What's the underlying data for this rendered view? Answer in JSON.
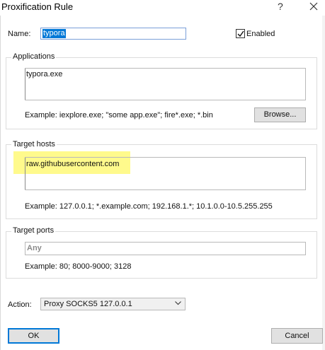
{
  "window": {
    "title": "Proxification Rule",
    "help_glyph": "?",
    "close_glyph": "×"
  },
  "name": {
    "label": "Name:",
    "value": "typora"
  },
  "enabled": {
    "label": "Enabled",
    "checked": true
  },
  "applications": {
    "title": "Applications",
    "value": "typora.exe",
    "example": "Example: iexplore.exe; \"some app.exe\"; fire*.exe; *.bin",
    "browse_label": "Browse..."
  },
  "target_hosts": {
    "title": "Target hosts",
    "value": "raw.githubusercontent.com",
    "example": "Example: 127.0.0.1; *.example.com; 192.168.1.*; 10.1.0.0-10.5.255.255"
  },
  "target_ports": {
    "title": "Target ports",
    "value": "Any",
    "example": "Example: 80; 8000-9000; 3128"
  },
  "action": {
    "label": "Action:",
    "selected": "Proxy SOCKS5 127.0.0.1"
  },
  "buttons": {
    "ok_label": "OK",
    "cancel_label": "Cancel"
  },
  "colors": {
    "accent": "#0078d7",
    "highlight": "#fff978"
  }
}
